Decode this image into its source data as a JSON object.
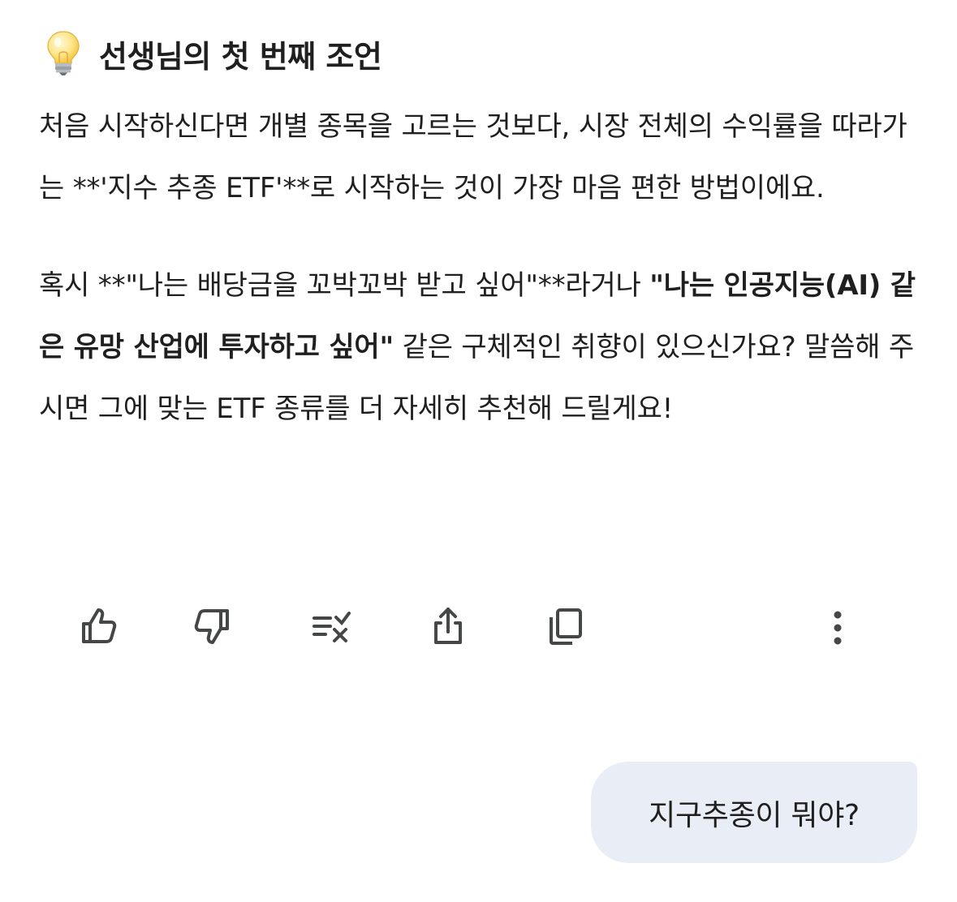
{
  "response": {
    "heading": "선생님의 첫 번째 조언",
    "heading_icon": "lightbulb-icon",
    "paragraph1": "처음 시작하신다면 개별 종목을 고르는 것보다, 시장 전체의 수익률을 따라가는 **'지수 추종 ETF'**로 시작하는 것이 가장 마음 편한 방법이에요.",
    "paragraph2": {
      "part1": "혹시 **\"나는 배당금을 꼬박꼬박 받고 싶어\"**라거나 ",
      "part2_bold": "\"나는 인공지능(AI) 같은 유망 산업에 투자하고 싶어\"",
      "part3": " 같은 구체적인 취향이 있으신가요? 말씀해 주시면 그에 맞는 ETF 종류를 더 자세히 추천해 드릴게요!"
    }
  },
  "actions": {
    "icons": [
      "thumbs-up-icon",
      "thumbs-down-icon",
      "modify-response-icon",
      "share-icon",
      "copy-icon",
      "more-vert-icon"
    ]
  },
  "user_message": {
    "text": "지구추종이 뭐야?"
  },
  "colors": {
    "text": "#1f1f1f",
    "icon": "#444746",
    "bubble_bg": "#e9eef6",
    "background": "#ffffff"
  }
}
